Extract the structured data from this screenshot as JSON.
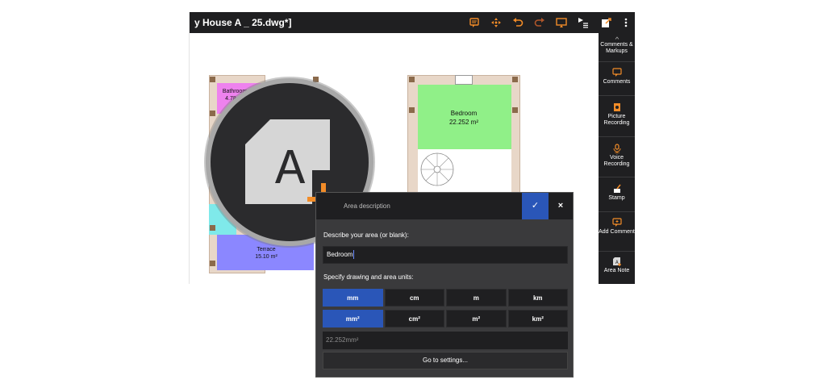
{
  "window": {
    "title": "y House A _ 25.dwg*]"
  },
  "toolbar": {
    "icons": [
      "comment-icon",
      "move-icon",
      "undo-icon",
      "redo-icon",
      "cast-icon",
      "play-list-icon",
      "export-icon",
      "more-icon"
    ],
    "accent": "#f28c28"
  },
  "right_panel": {
    "header": "Comments & Markups",
    "items": [
      {
        "label": "Comments",
        "icon": "comment-icon"
      },
      {
        "label": "Picture Recording",
        "icon": "picture-icon"
      },
      {
        "label": "Voice Recording",
        "icon": "microphone-icon"
      },
      {
        "label": "Stamp",
        "icon": "stamp-icon"
      },
      {
        "label": "Add Comment",
        "icon": "add-comment-icon"
      },
      {
        "label": "Area Note",
        "icon": "area-note-icon"
      }
    ]
  },
  "plan": {
    "bathroom": {
      "name": "Bathroom",
      "area": "4.78 m²"
    },
    "bedroom": {
      "name": "Bedroom",
      "area": "22.252 m²"
    },
    "terrace": {
      "name": "Terrace",
      "area": "15.10 m²"
    }
  },
  "badge": {
    "letter": "A",
    "icon": "area-note-add-icon"
  },
  "dialog": {
    "title": "Area description",
    "describe_label": "Describe your area (or blank):",
    "describe_value": "Bedroom",
    "units_label": "Specify drawing and area units:",
    "length_units": [
      "mm",
      "cm",
      "m",
      "km"
    ],
    "area_units": [
      "mm²",
      "cm²",
      "m²",
      "km²"
    ],
    "readout": "22.252mm²",
    "settings_button": "Go to settings...",
    "ok_icon": "✓",
    "close_icon": "×",
    "colors": {
      "primary": "#2a56b8",
      "panel": "#1f1f21"
    }
  }
}
